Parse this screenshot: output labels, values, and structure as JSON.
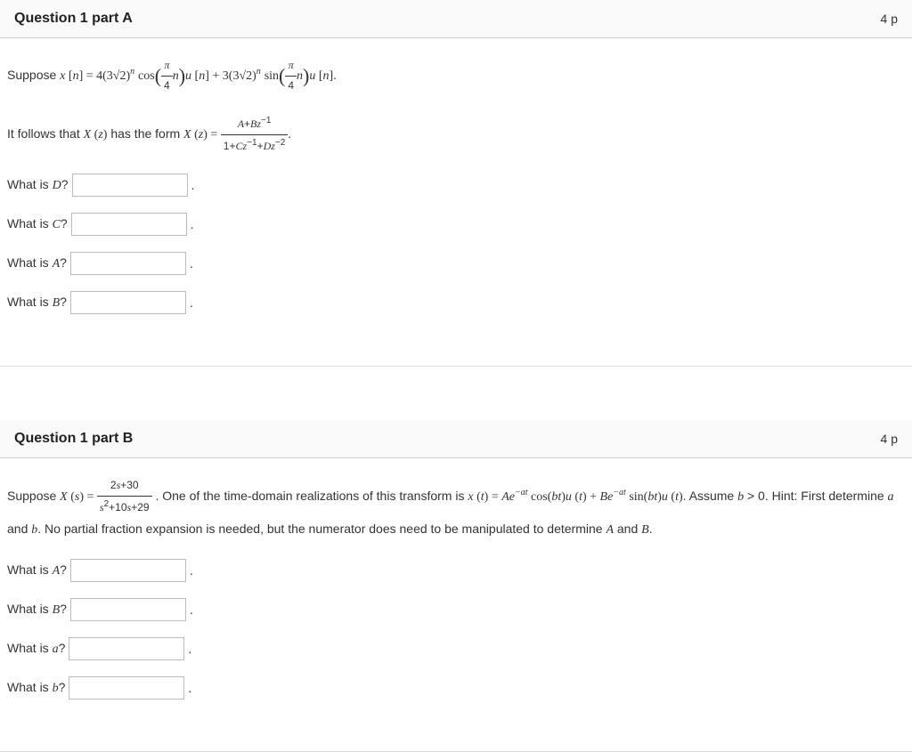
{
  "partA": {
    "title": "Question 1 part A",
    "points": "4 p",
    "suppose_prefix": "Suppose ",
    "equation_text": "x [n] = 4(3√2)ⁿ cos((π/4)n)u[n] + 3(3√2)ⁿ sin((π/4)n)u[n].",
    "follows_prefix": "It follows that ",
    "follows_mid": " has the form ",
    "xz_label": "X (z)",
    "xz_eq": " = ",
    "frac_num": "A+Bz⁻¹",
    "frac_den": "1+Cz⁻¹+Dz⁻²",
    "frac_end": ".",
    "qD": "What is D?",
    "qC": "What is C?",
    "qA": "What is A?",
    "qB": "What is B?"
  },
  "partB": {
    "title": "Question 1 part B",
    "points": "4 p",
    "suppose_prefix": "Suppose ",
    "xs_label": "X (s) = ",
    "frac_num": "2s+30",
    "frac_den": "s²+10s+29",
    "text_after_frac": " . One of the time-domain realizations of this transform is ",
    "xt_eq": "x (t) = Ae⁻ᵃᵗ cos(bt)u(t) + Be⁻ᵃᵗ sin(bt)u(t)",
    "assume_text": ". Assume b > 0. Hint: First determine a and b. No partial fraction expansion is needed, but the numerator does need to be manipulated to determine A and B.",
    "qA": "What is A?",
    "qB": "What is B?",
    "qa": "What is a?",
    "qb": "What is b?"
  }
}
